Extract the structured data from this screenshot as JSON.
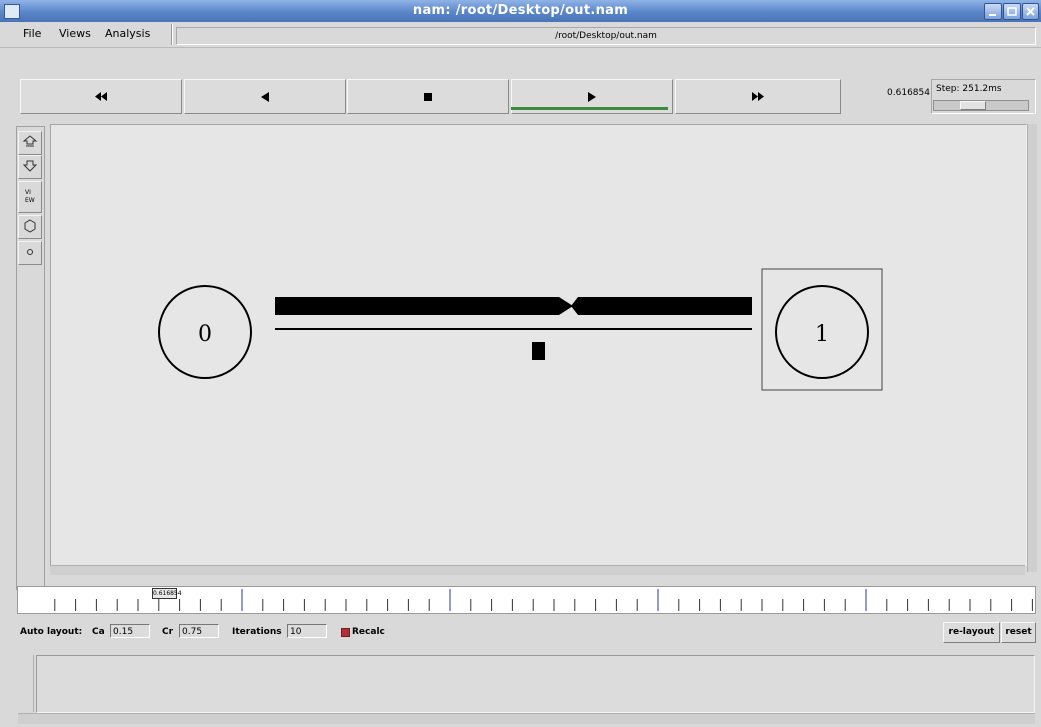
{
  "window": {
    "title": "nam: /root/Desktop/out.nam"
  },
  "menu": {
    "file": "File",
    "views": "Views",
    "analysis": "Analysis"
  },
  "file_path": "/root/Desktop/out.nam",
  "transport": {
    "rewind": "rewind-icon",
    "back": "step-back-icon",
    "stop": "stop-icon",
    "play": "play-icon",
    "forward": "fast-forward-icon",
    "active": "play",
    "time": "0.616854",
    "step_label": "Step: 251.2ms"
  },
  "nodes": [
    {
      "label": "0",
      "shape": "circle"
    },
    {
      "label": "1",
      "shape": "circle-in-square"
    }
  ],
  "timeline": {
    "marker": "0.616854"
  },
  "autolayout": {
    "label": "Auto layout:",
    "ca_label": "Ca",
    "ca_value": "0.15",
    "cr_label": "Cr",
    "cr_value": "0.75",
    "iterations_label": "Iterations",
    "iterations_value": "10",
    "recalc_label": "Recalc",
    "recalc_checked": true,
    "relayout_button": "re-layout",
    "reset_button": "reset"
  },
  "colors": {
    "titlebar": "#5a86c9",
    "play_indicator": "#3a8c3a",
    "canvas": "#e6e6e6"
  }
}
